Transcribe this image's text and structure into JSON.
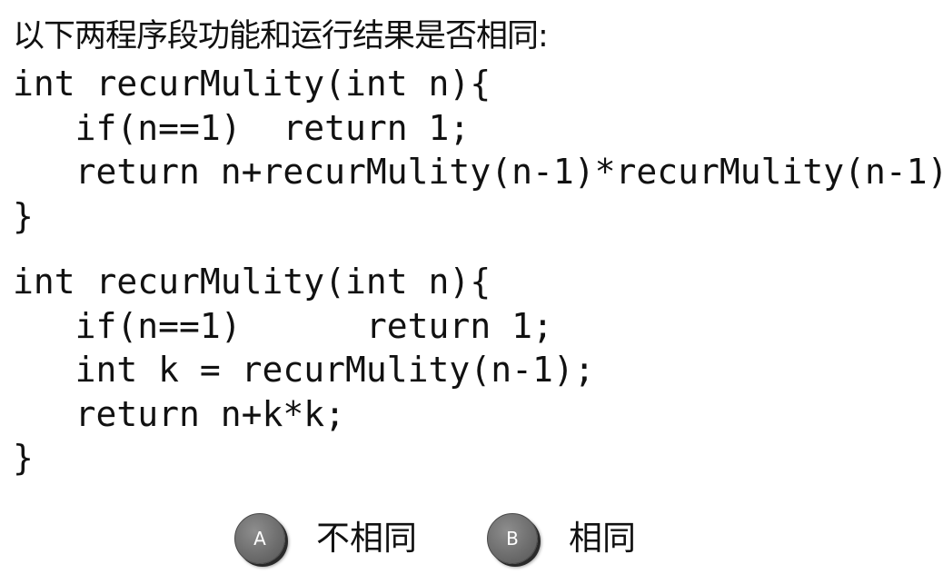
{
  "question": {
    "text": "以下两程序段功能和运行结果是否相同:"
  },
  "code_block_1": {
    "lines": [
      "int recurMulity(int n){",
      "   if(n==1)  return 1;",
      "   return n+recurMulity(n-1)*recurMulity(n-1);",
      "}"
    ]
  },
  "code_block_2": {
    "lines": [
      "int recurMulity(int n){",
      "   if(n==1)      return 1;",
      "   int k = recurMulity(n-1);",
      "   return n+k*k;",
      "}"
    ]
  },
  "options": [
    {
      "letter": "A",
      "text": "不相同"
    },
    {
      "letter": "B",
      "text": "相同"
    }
  ]
}
